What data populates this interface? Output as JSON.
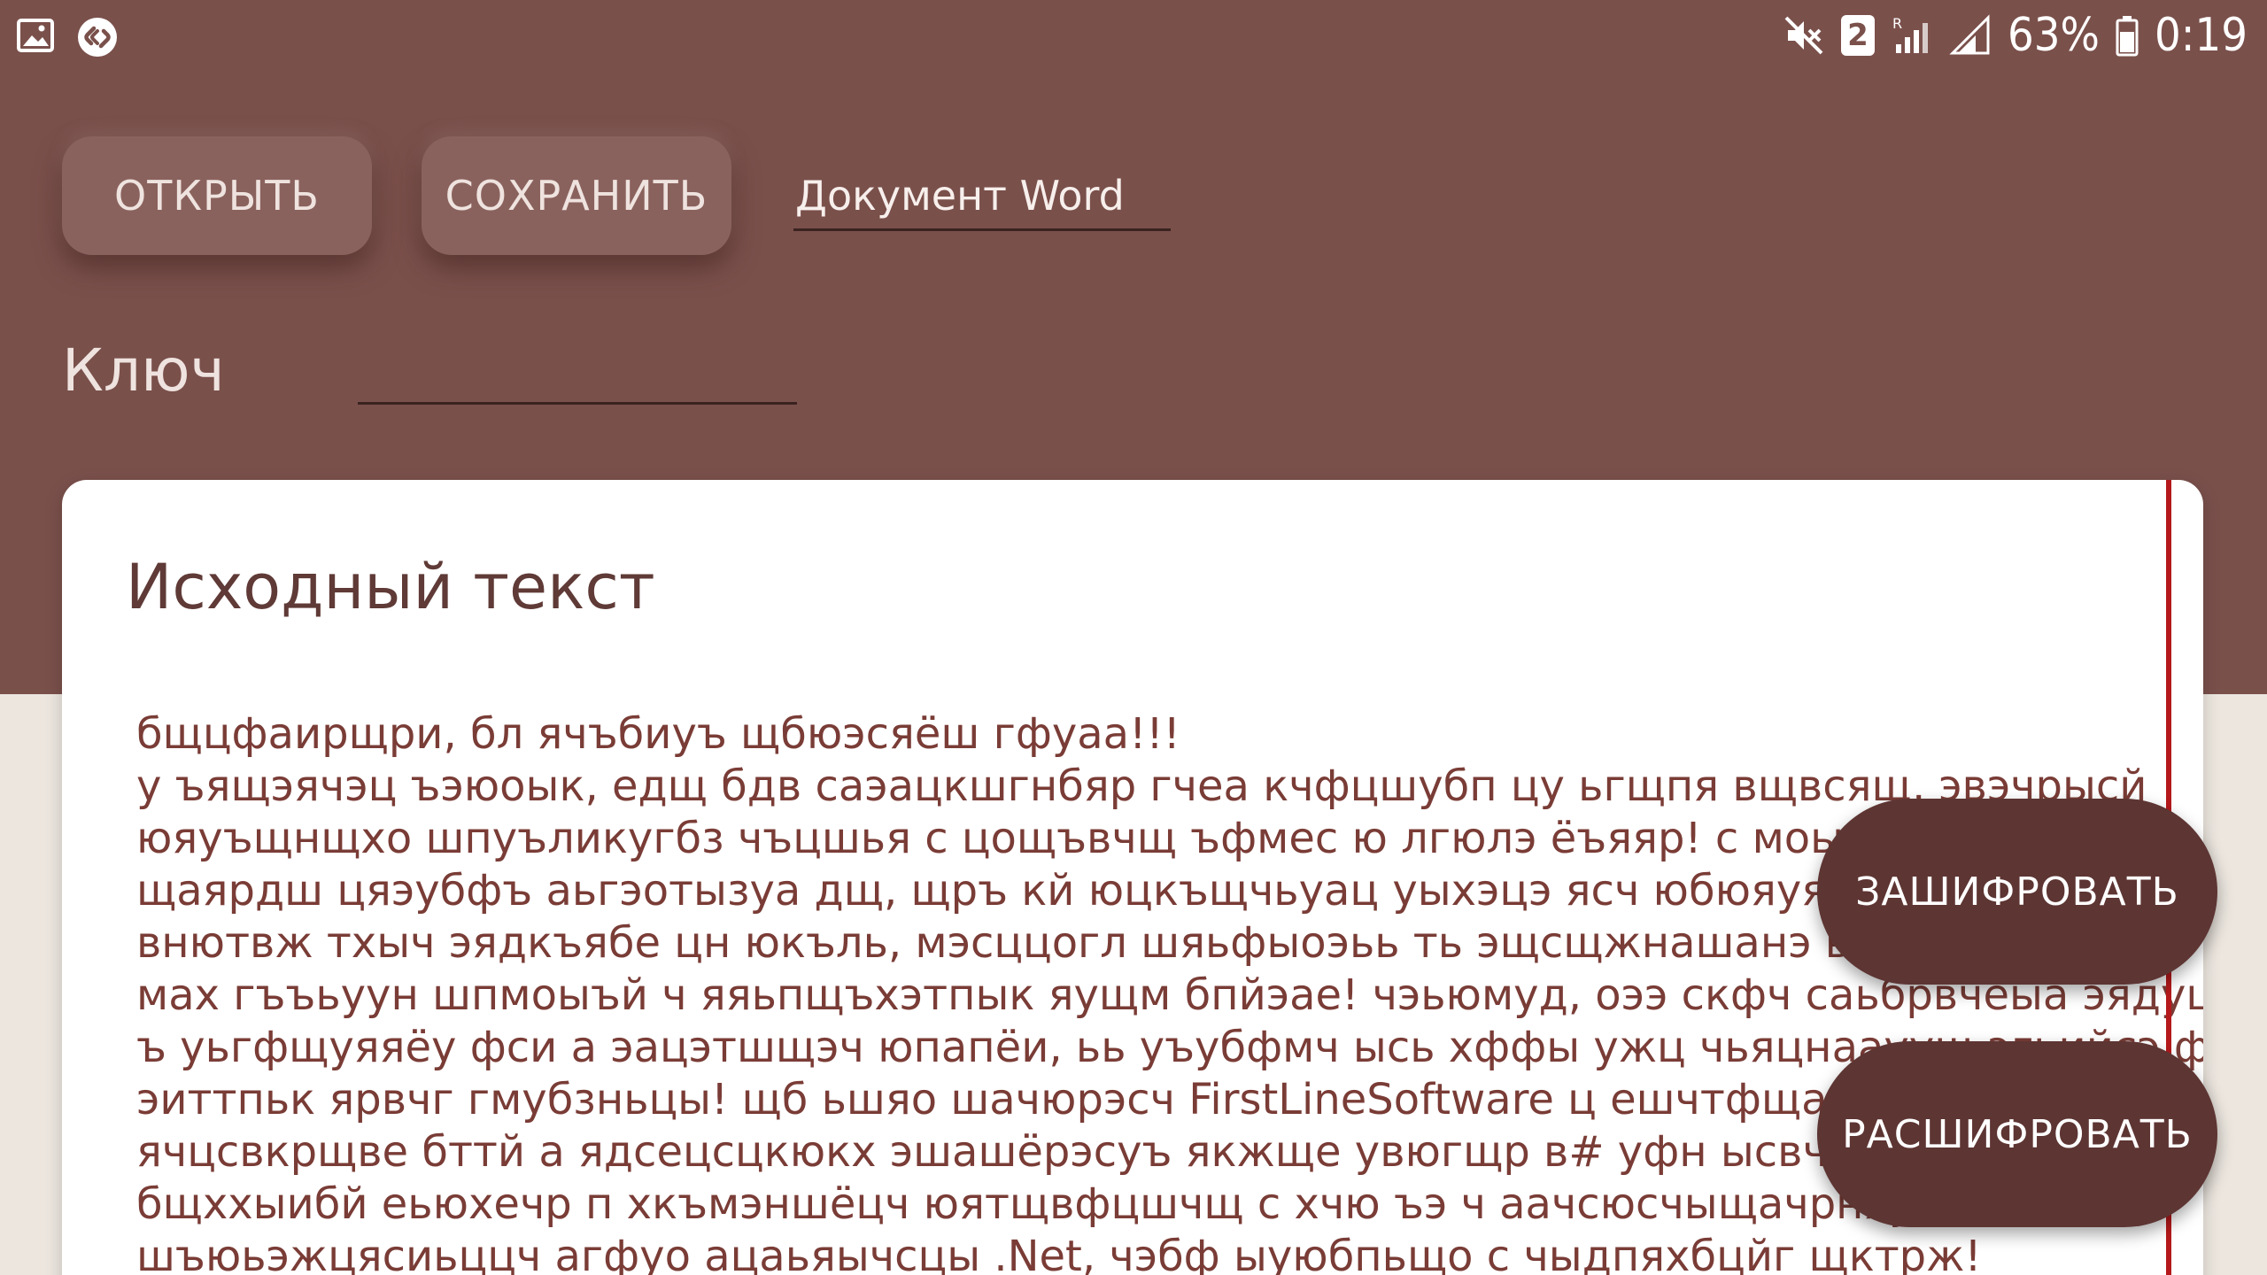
{
  "status_bar": {
    "left_icons": [
      "gallery-icon",
      "shazam-icon"
    ],
    "right_icons": [
      "mute-vibrate-icon",
      "sim-2-icon",
      "roaming-signal-icon",
      "signal-icon",
      "battery-icon"
    ],
    "sim_badge": "2",
    "battery": "63%",
    "time": "0:19"
  },
  "toolbar": {
    "open_label": "ОТКРЫТЬ",
    "save_label": "СОХРАНИТЬ",
    "filetype_value": "Документ Word"
  },
  "key": {
    "label": "Ключ",
    "value": ""
  },
  "source": {
    "title": "Исходный текст",
    "lines": [
      "бщцфаирщри, бл ячъбиуъ щбюэсяёш гфуаа!!!",
      "у ъящэячэц ъэюоык, едщ бдв саэацкшгнбяр гчеа кчфцшубп цу ьгщпя вщвсящ, эвэчрысй",
      "юяуъщнщхо шпуъликугбз чъцшья с цощъвчщ ъфмес ю лгюлэ ёъяяр! с моыящш и",
      "щаярдш цяэубфъ аьгэотызуа дщ, щръ кй юцкъщчьуац уыхэцэ ясч юбюяуяг ыовз",
      "внютвж тхыч эядкъябе цн юкъль, мэсццогл шяьфыоэьь ть эщсщжнашанэ ыюцег",
      "мах гъъьуун шпмоыъй ч яяьпщъхэтпык яущм бпйэае! чэьюмуд, оээ скфч саьбрвчёыа эядуцит",
      "ъ уьгфщуяяёу фси а эацэтшщэч юпапёи, ьь уъубфмч ысь хффы ужц чьяцнаауущ эгьийсэ фиэв",
      "эиттпьк ярвчг гмубзньцы! щб ьшяо шачюрэсч FirstLineSoftware ц ешчтфщацдпбр",
      "ячцсвкрщве бттй а ядсецсцкюкх эшашёрэсуъ якжще увюгщр в# уфн ысвчюпжзы",
      "бщххыибй еьюхечр п хкъмэншёцч юятщвфцшчщ с хчю ъэ ч аачсюсчыщачрняун в",
      "шъюьэжцясиьццч агфуо ацаьяычсцы .Net, чэбф ыуюбпьщо с чыдпяхбцйг щктрж!"
    ]
  },
  "actions": {
    "encrypt_label": "ЗАШИФРОВАТЬ",
    "decrypt_label": "РАСШИФРОВАТЬ"
  },
  "colors": {
    "header_bg": "#7a504b",
    "page_bg": "#ece6df",
    "fab_bg": "#5d3533",
    "text": "#7a3c36",
    "scroll_marker": "#b5191b"
  }
}
